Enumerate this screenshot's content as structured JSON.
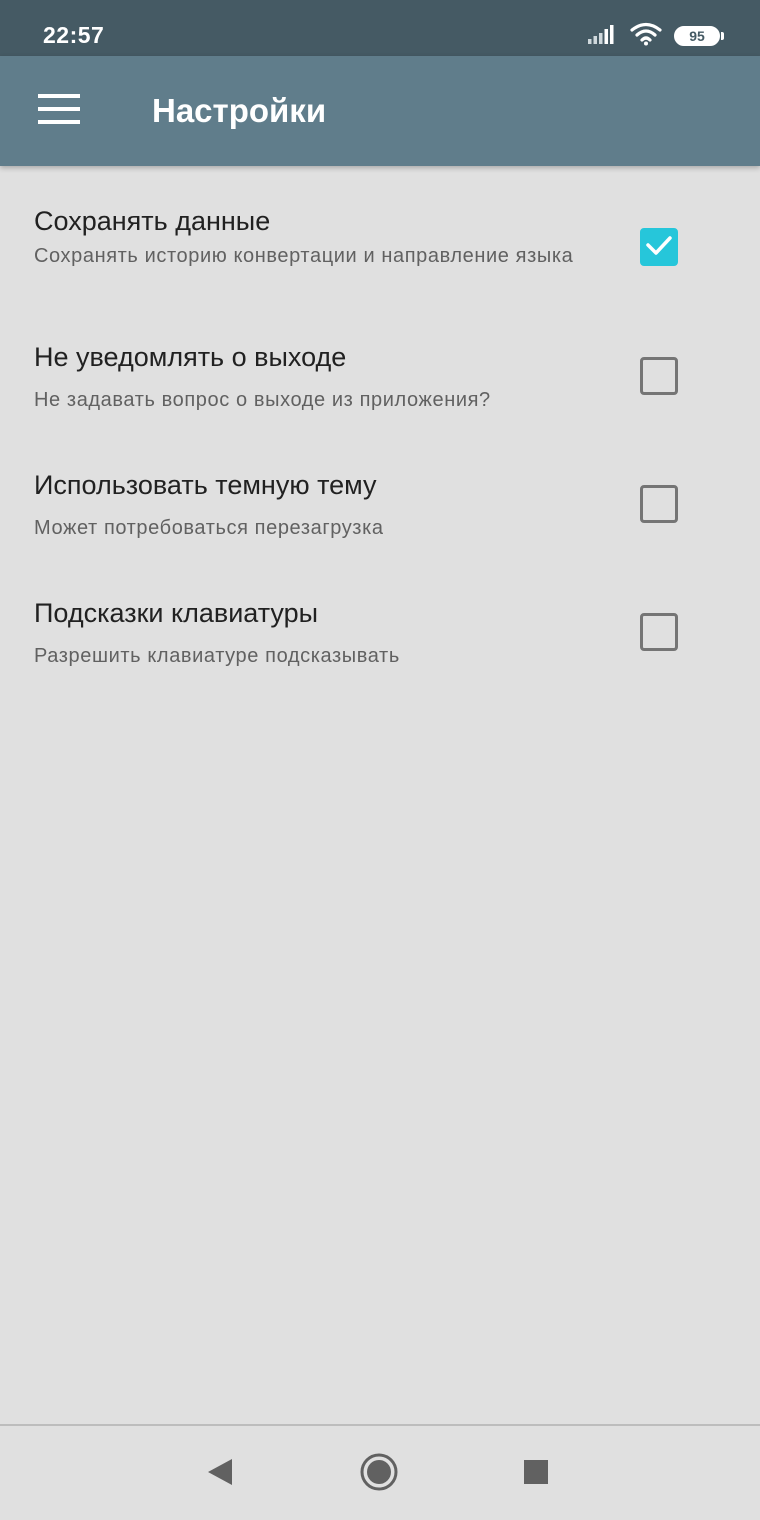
{
  "status_bar": {
    "time": "22:57",
    "battery_level": "95",
    "icons": [
      "signal-icon",
      "wifi-icon",
      "battery-icon"
    ]
  },
  "app_bar": {
    "title": "Настройки",
    "menu_icon": "hamburger-menu-icon"
  },
  "settings": [
    {
      "title": "Сохранять данные",
      "summary": "Сохранять историю конвертации и направление языка",
      "checked": true
    },
    {
      "title": "Не уведомлять о выходе",
      "summary": "Не задавать вопрос о выходе из приложения?",
      "checked": false
    },
    {
      "title": "Использовать темную тему",
      "summary": "Может потребоваться перезагрузка",
      "checked": false
    },
    {
      "title": "Подсказки клавиатуры",
      "summary": "Разрешить клавиатуре подсказывать",
      "checked": false
    }
  ],
  "nav_bar": {
    "icons": [
      "back-icon",
      "home-icon",
      "recents-icon"
    ]
  },
  "colors": {
    "status_bar": "#455a64",
    "app_bar": "#607d8b",
    "background": "#e0e0e0",
    "accent": "#26c6da"
  }
}
